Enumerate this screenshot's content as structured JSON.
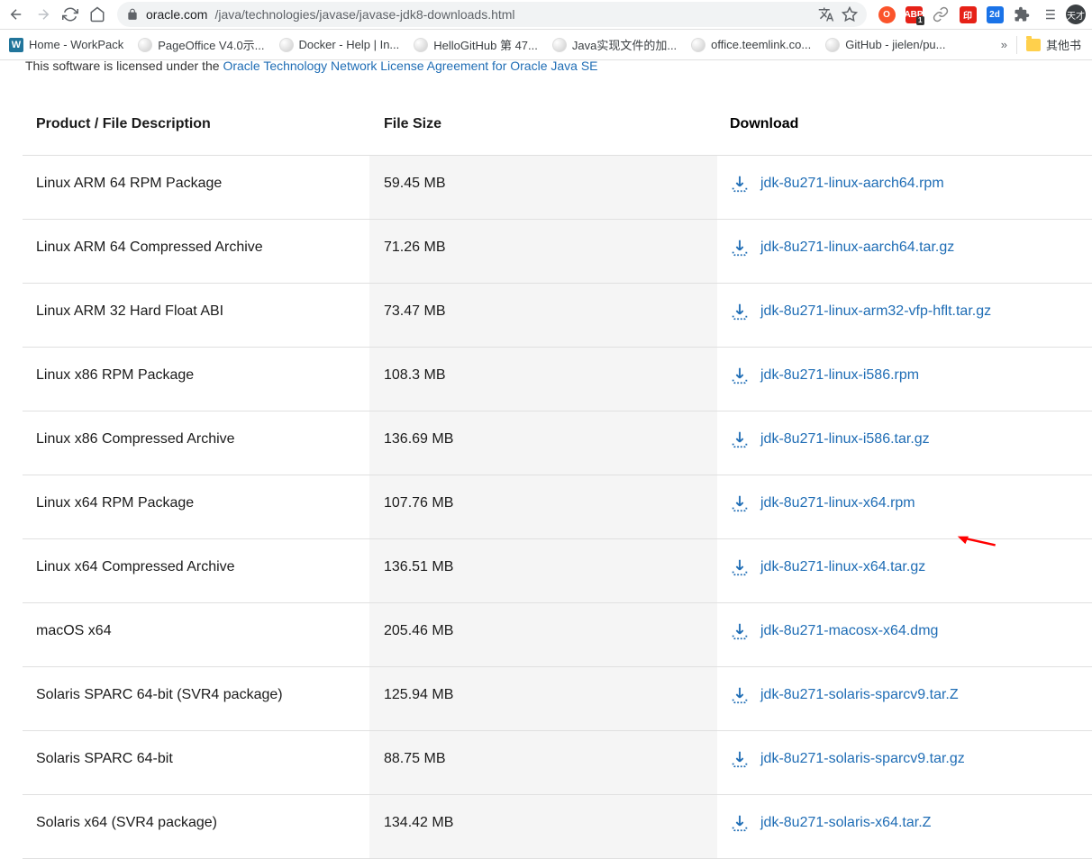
{
  "browser": {
    "url_host": "oracle.com",
    "url_path": "/java/technologies/javase/javase-jdk8-downloads.html",
    "nav": {
      "back": true,
      "forward": false
    },
    "abp_count": "1",
    "avatar_text": "天才",
    "overflow": "»"
  },
  "bookmarks": [
    {
      "icon": "wordpress",
      "label": "Home - WorkPack"
    },
    {
      "icon": "globe",
      "label": "PageOffice V4.0示..."
    },
    {
      "icon": "globe",
      "label": "Docker - Help | In..."
    },
    {
      "icon": "globe",
      "label": "HelloGitHub 第 47..."
    },
    {
      "icon": "globe",
      "label": "Java实现文件的加..."
    },
    {
      "icon": "globe",
      "label": "office.teemlink.co..."
    },
    {
      "icon": "globe",
      "label": "GitHub - jielen/pu..."
    }
  ],
  "other_bookmarks_label": "其他书",
  "license": {
    "prefix": "This software is licensed under the ",
    "link_text": "Oracle Technology Network License Agreement for Oracle Java SE"
  },
  "table": {
    "headers": {
      "product": "Product / File Description",
      "size": "File Size",
      "download": "Download"
    },
    "rows": [
      {
        "product": "Linux ARM 64 RPM Package",
        "size": "59.45 MB",
        "file": "jdk-8u271-linux-aarch64.rpm"
      },
      {
        "product": "Linux ARM 64 Compressed Archive",
        "size": "71.26 MB",
        "file": "jdk-8u271-linux-aarch64.tar.gz"
      },
      {
        "product": "Linux ARM 32 Hard Float ABI",
        "size": "73.47 MB",
        "file": "jdk-8u271-linux-arm32-vfp-hflt.tar.gz"
      },
      {
        "product": "Linux x86 RPM Package",
        "size": "108.3 MB",
        "file": "jdk-8u271-linux-i586.rpm"
      },
      {
        "product": "Linux x86 Compressed Archive",
        "size": "136.69 MB",
        "file": "jdk-8u271-linux-i586.tar.gz"
      },
      {
        "product": "Linux x64 RPM Package",
        "size": "107.76 MB",
        "file": "jdk-8u271-linux-x64.rpm"
      },
      {
        "product": "Linux x64 Compressed Archive",
        "size": "136.51 MB",
        "file": "jdk-8u271-linux-x64.tar.gz",
        "annotated": true
      },
      {
        "product": "macOS x64",
        "size": "205.46 MB",
        "file": "jdk-8u271-macosx-x64.dmg"
      },
      {
        "product": "Solaris SPARC 64-bit (SVR4 package)",
        "size": "125.94 MB",
        "file": "jdk-8u271-solaris-sparcv9.tar.Z"
      },
      {
        "product": "Solaris SPARC 64-bit",
        "size": "88.75 MB",
        "file": "jdk-8u271-solaris-sparcv9.tar.gz"
      },
      {
        "product": "Solaris x64 (SVR4 package)",
        "size": "134.42 MB",
        "file": "jdk-8u271-solaris-x64.tar.Z"
      }
    ]
  }
}
